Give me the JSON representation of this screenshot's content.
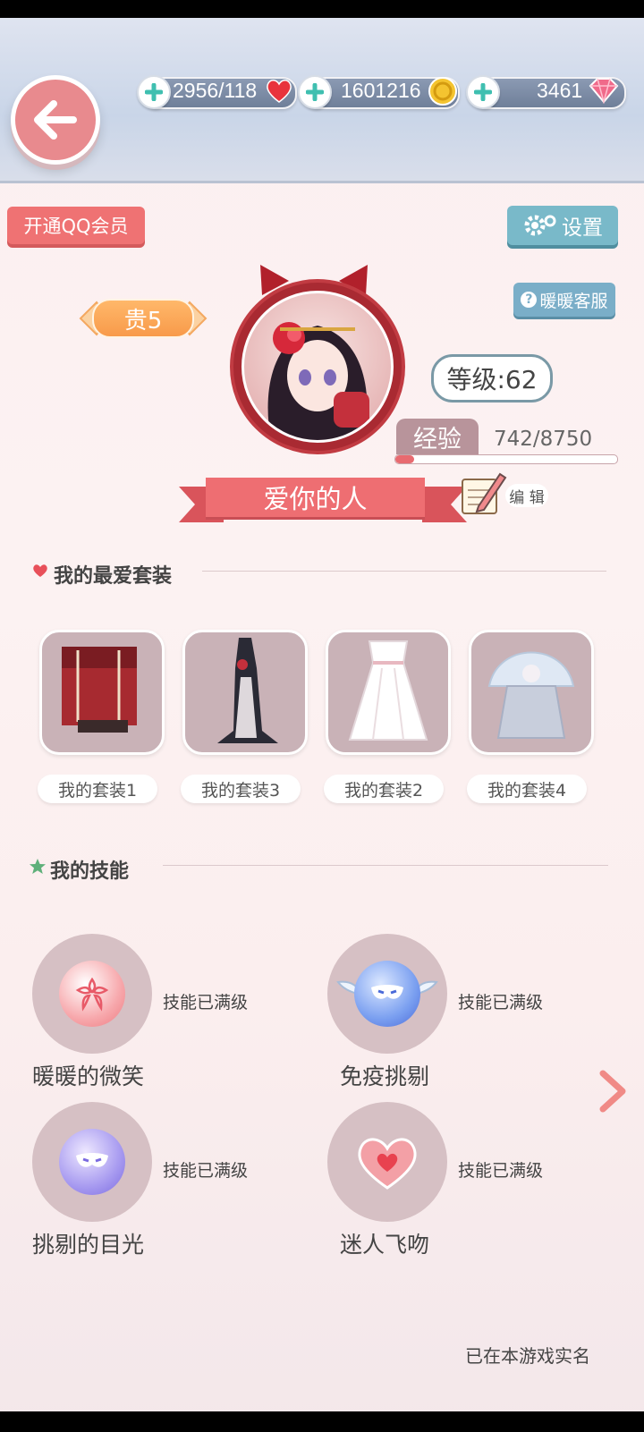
{
  "header": {
    "stamina": "2956/118",
    "coins": "1601216",
    "diamonds": "3461"
  },
  "buttons": {
    "qq_vip": "开通QQ会员",
    "settings": "设置",
    "customer_service": "暖暖客服",
    "edit": "编 辑"
  },
  "profile": {
    "vip_level": "贵5",
    "level": "等级:62",
    "exp_label": "经验",
    "exp_value": "742/8750",
    "exp_fraction": 0.085,
    "nickname": "爱你的人"
  },
  "favorites": {
    "title": "我的最爱套装",
    "suits": [
      "我的套装1",
      "我的套装3",
      "我的套装2",
      "我的套装4"
    ]
  },
  "skills": {
    "title": "我的技能",
    "items": [
      {
        "name": "暖暖的微笑",
        "status": "技能已满级"
      },
      {
        "name": "免疫挑剔",
        "status": "技能已满级"
      },
      {
        "name": "挑剔的目光",
        "status": "技能已满级"
      },
      {
        "name": "迷人飞吻",
        "status": "技能已满级"
      }
    ]
  },
  "footer": {
    "realname_text": "已在本游戏实名"
  },
  "colors": {
    "accent_red": "#ee6e72",
    "header_pill": "#7b8ba5"
  },
  "icons": [
    "back-arrow-icon",
    "plus-icon",
    "heart-icon",
    "coin-icon",
    "diamond-icon",
    "gear-icon",
    "question-icon",
    "pencil-notebook-icon",
    "chevron-right-icon",
    "star-icon"
  ]
}
